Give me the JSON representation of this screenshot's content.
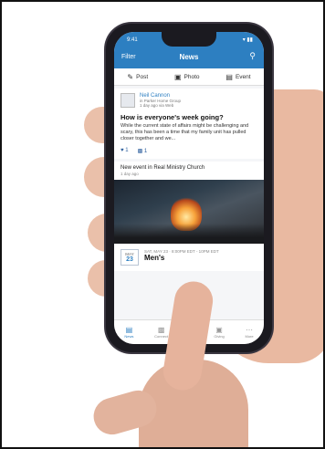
{
  "status": {
    "time": "9:41",
    "right": "▾ ▮▮"
  },
  "nav": {
    "filter": "Filter",
    "title": "News"
  },
  "actions": [
    {
      "label": "Post",
      "icon": "pencil-icon"
    },
    {
      "label": "Photo",
      "icon": "camera-icon"
    },
    {
      "label": "Event",
      "icon": "calendar-icon"
    }
  ],
  "post": {
    "author": "Neil Cannon",
    "meta_line1": "in Parker Home Group",
    "meta_line2": "1 day ago via Web",
    "title": "How is everyone's week going?",
    "body": "While the current state of affairs might be challenging and scary, this has been a time that my family unit has pulled closer together and we...",
    "likes": "1",
    "comments": "1"
  },
  "event": {
    "headline": "New event in Real Ministry Church",
    "time_ago": "1 day ago",
    "month": "MAY",
    "day": "23",
    "when": "SAT, MAY 23 · 8:00PM EDT - 10PM EDT",
    "name": "Men's"
  },
  "tabs": [
    {
      "label": "News",
      "icon": "news-icon",
      "active": true
    },
    {
      "label": "Connect",
      "icon": "chat-icon",
      "active": false
    },
    {
      "label": "",
      "icon": "groups-icon",
      "active": false
    },
    {
      "label": "Giving",
      "icon": "giving-icon",
      "active": false
    },
    {
      "label": "More",
      "icon": "more-icon",
      "active": false
    }
  ]
}
